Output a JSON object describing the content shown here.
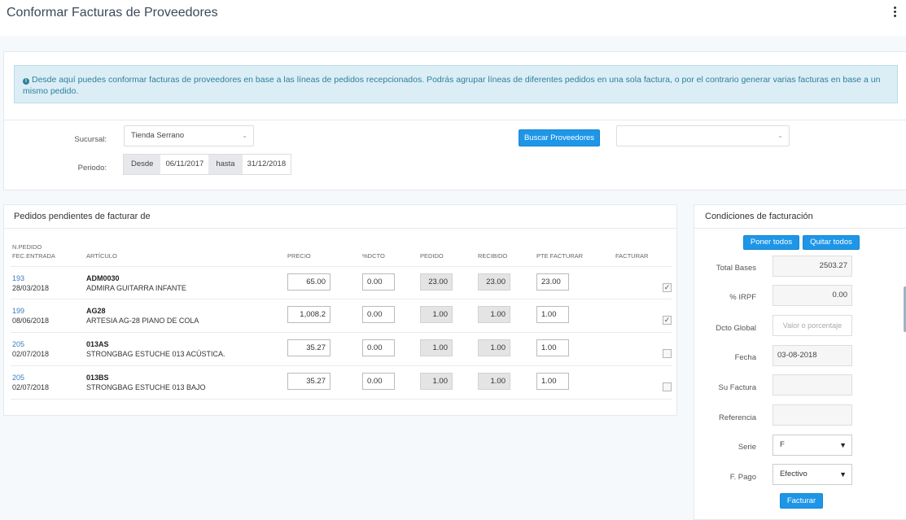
{
  "header": {
    "title": "Conformar Facturas de Proveedores"
  },
  "info": {
    "message": "Desde aquí puedes conformar facturas de proveedores en base a las líneas de pedidos recepcionados. Podrás agrupar líneas de diferentes pedidos en una sola factura, o por el contrario generar varias facturas en base a un mismo pedido."
  },
  "filters": {
    "sucursal_label": "Sucursal:",
    "sucursal_value": "Tienda Serrano",
    "periodo_label": "Periodo:",
    "desde_label": "Desde",
    "desde_value": "06/11/2017",
    "hasta_label": "hasta",
    "hasta_value": "31/12/2018",
    "buscar_button": "Buscar Proveedores",
    "proveedor_value": ""
  },
  "orders": {
    "title": "Pedidos pendientes de facturar de",
    "headers": {
      "npedido": "N.PEDIDO",
      "fecentrada": "FEC.ENTRADA",
      "articulo": "ARTÍCULO",
      "precio": "PRECIO",
      "dcto": "%DCTO",
      "pedido": "PEDIDO",
      "recibido": "RECIBIDO",
      "pte": "PTE FACTURAR",
      "facturar": "FACTURAR"
    },
    "rows": [
      {
        "npedido": "193",
        "fecha": "28/03/2018",
        "codigo": "ADM0030",
        "descripcion": "ADMIRA GUITARRA INFANTE",
        "precio": "65.00",
        "dcto": "0.00",
        "pedido": "23.00",
        "recibido": "23.00",
        "pte": "23.00",
        "facturar": true
      },
      {
        "npedido": "199",
        "fecha": "08/06/2018",
        "codigo": "AG28",
        "descripcion": "ARTESIA AG-28 PIANO DE COLA",
        "precio": "1,008.2",
        "dcto": "0.00",
        "pedido": "1.00",
        "recibido": "1.00",
        "pte": "1.00",
        "facturar": true
      },
      {
        "npedido": "205",
        "fecha": "02/07/2018",
        "codigo": "013AS",
        "descripcion": "STRONGBAG ESTUCHE 013 ACÚSTICA.",
        "precio": "35.27",
        "dcto": "0.00",
        "pedido": "1.00",
        "recibido": "1.00",
        "pte": "1.00",
        "facturar": false
      },
      {
        "npedido": "205",
        "fecha": "02/07/2018",
        "codigo": "013BS",
        "descripcion": "STRONGBAG ESTUCHE 013 BAJO",
        "precio": "35.27",
        "dcto": "0.00",
        "pedido": "1.00",
        "recibido": "1.00",
        "pte": "1.00",
        "facturar": false
      }
    ]
  },
  "conditions": {
    "title": "Condiciones de facturación",
    "poner_todos": "Poner todos",
    "quitar_todos": "Quitar todos",
    "total_bases_label": "Total Bases",
    "total_bases_value": "2503.27",
    "irpf_label": "% IRPF",
    "irpf_value": "0.00",
    "dcto_global_label": "Dcto Global",
    "dcto_global_placeholder": "Valor o porcentaje",
    "fecha_label": "Fecha",
    "fecha_value": "03-08-2018",
    "su_factura_label": "Su Factura",
    "su_factura_value": "",
    "referencia_label": "Referencia",
    "referencia_value": "",
    "serie_label": "Serie",
    "serie_value": "F",
    "fpago_label": "F. Pago",
    "fpago_value": "Efectivo",
    "facturar_button": "Facturar"
  }
}
